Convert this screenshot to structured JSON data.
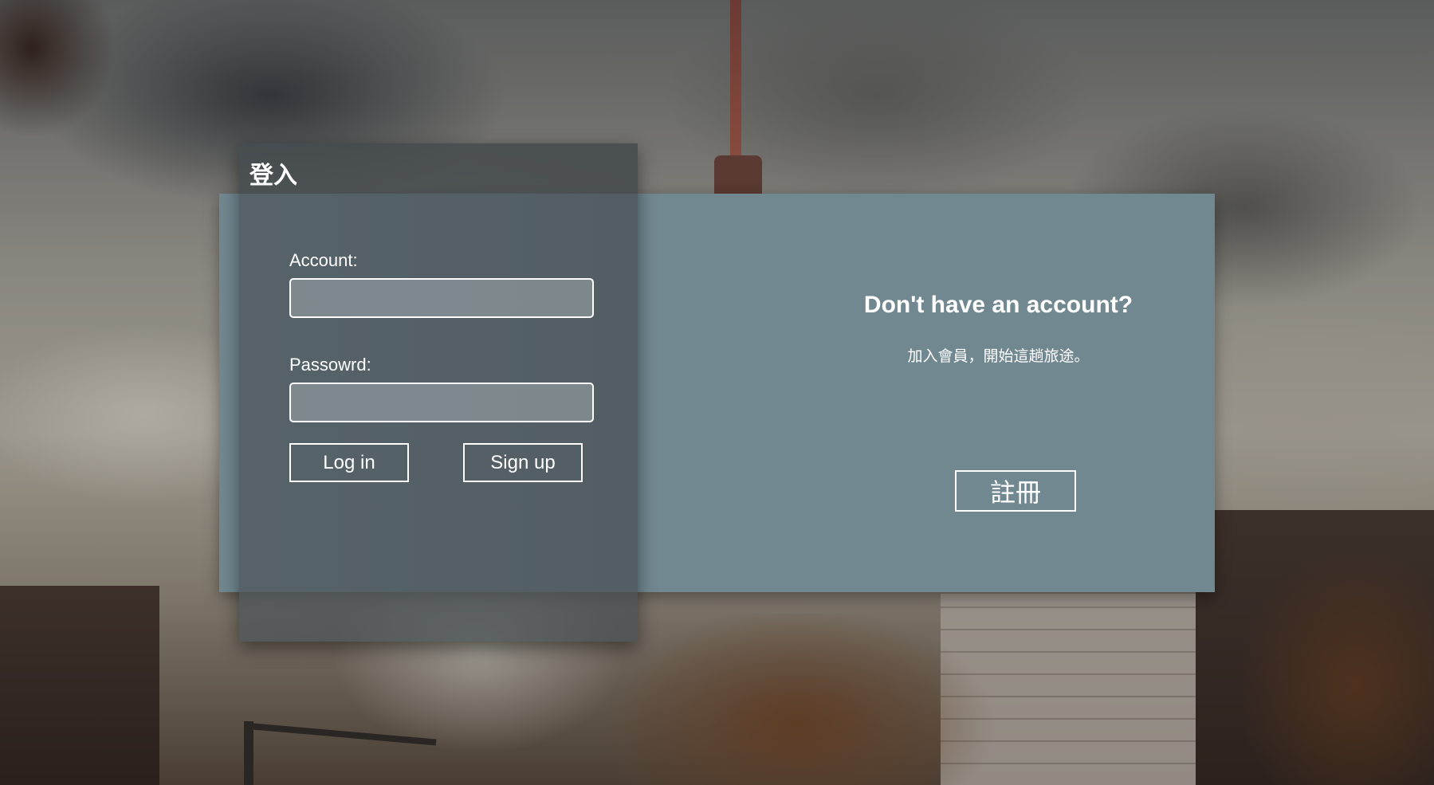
{
  "login": {
    "title": "登入",
    "account_label": "Account:",
    "account_value": "",
    "password_label": "Passowrd:",
    "password_value": "",
    "login_button": "Log in",
    "signup_button": "Sign up"
  },
  "signup_cta": {
    "heading": "Don't have an account?",
    "subtext": "加入會員，開始這趟旅途。",
    "register_button": "註冊"
  },
  "colors": {
    "card_background": "#728891",
    "panel_background": "#4b5458",
    "text": "#ffffff"
  }
}
